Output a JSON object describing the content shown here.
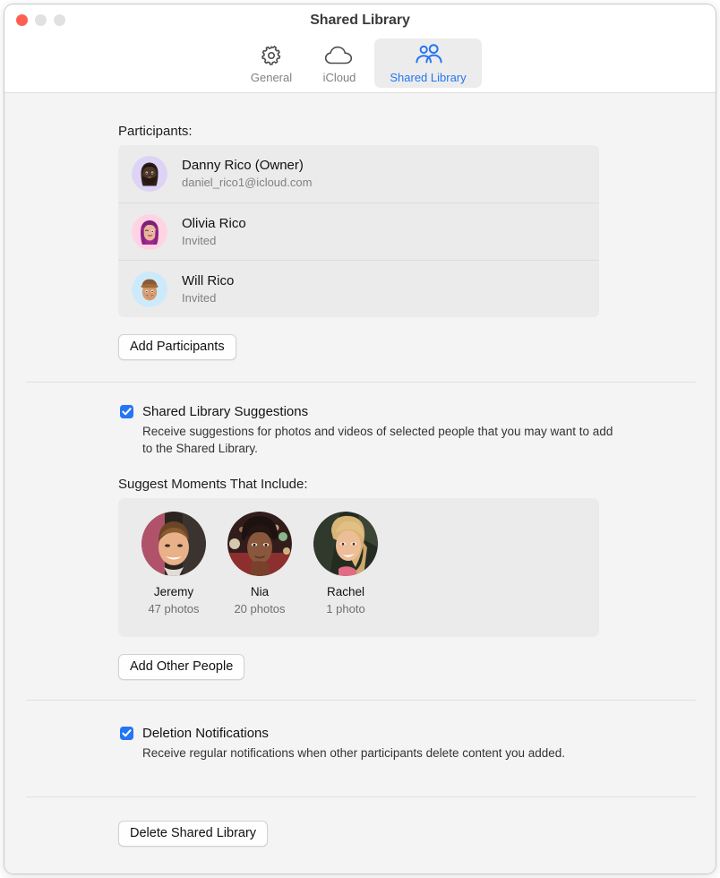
{
  "window": {
    "title": "Shared Library",
    "traffic_lights": [
      "close",
      "minimize",
      "maximize"
    ]
  },
  "toolbar": {
    "items": [
      {
        "label": "General",
        "icon": "gear-icon",
        "selected": false
      },
      {
        "label": "iCloud",
        "icon": "cloud-icon",
        "selected": false
      },
      {
        "label": "Shared Library",
        "icon": "people-icon",
        "selected": true
      }
    ],
    "selected_color": "#2476f4"
  },
  "participants": {
    "label": "Participants:",
    "rows": [
      {
        "name": "Danny Rico (Owner)",
        "status": "daniel_rico1@icloud.com",
        "avatar": "memoji-danny",
        "avatar_bg": "#ddd4f5"
      },
      {
        "name": "Olivia Rico",
        "status": "Invited",
        "avatar": "memoji-olivia",
        "avatar_bg": "#ffd3e3"
      },
      {
        "name": "Will Rico",
        "status": "Invited",
        "avatar": "memoji-will",
        "avatar_bg": "#cdeafb"
      }
    ],
    "add_button": "Add Participants"
  },
  "suggestions": {
    "checkbox_label": "Shared Library Suggestions",
    "checked": true,
    "description": "Receive suggestions for photos and videos of selected people that you may want to add to the Shared Library.",
    "moments_label": "Suggest Moments That Include:",
    "people": [
      {
        "name": "Jeremy",
        "count": "47 photos",
        "photo": "photo-jeremy"
      },
      {
        "name": "Nia",
        "count": "20 photos",
        "photo": "photo-nia"
      },
      {
        "name": "Rachel",
        "count": "1 photo",
        "photo": "photo-rachel"
      }
    ],
    "add_button": "Add Other People"
  },
  "deletion": {
    "checkbox_label": "Deletion Notifications",
    "checked": true,
    "description": "Receive regular notifications when other participants delete content you added."
  },
  "footer": {
    "delete_button": "Delete Shared Library"
  }
}
